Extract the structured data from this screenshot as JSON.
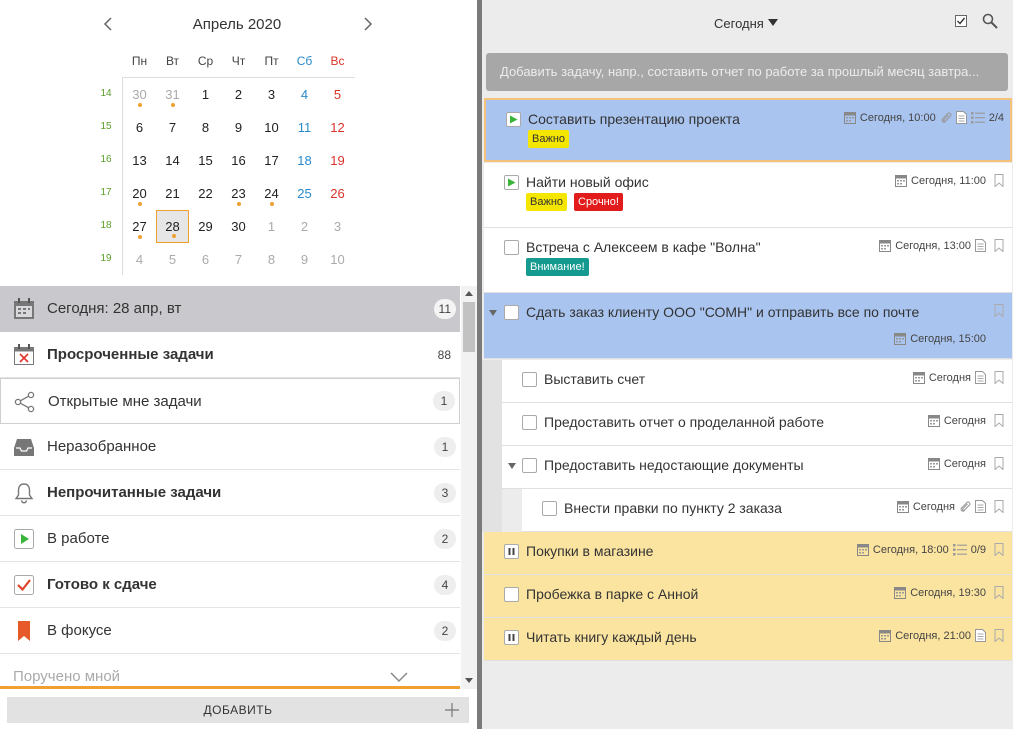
{
  "calendar": {
    "title": "Апрель 2020",
    "prev": "<",
    "next": ">",
    "weekdays": [
      "Пн",
      "Вт",
      "Ср",
      "Чт",
      "Пт",
      "Сб",
      "Вс"
    ],
    "weeknums": [
      "14",
      "15",
      "16",
      "17",
      "18",
      "19"
    ],
    "days": [
      {
        "d": "30",
        "other": true,
        "dot": true
      },
      {
        "d": "31",
        "other": true,
        "dot": true
      },
      {
        "d": "1"
      },
      {
        "d": "2"
      },
      {
        "d": "3"
      },
      {
        "d": "4"
      },
      {
        "d": "5"
      },
      {
        "d": "6"
      },
      {
        "d": "7"
      },
      {
        "d": "8"
      },
      {
        "d": "9"
      },
      {
        "d": "10"
      },
      {
        "d": "11"
      },
      {
        "d": "12"
      },
      {
        "d": "13"
      },
      {
        "d": "14"
      },
      {
        "d": "15"
      },
      {
        "d": "16"
      },
      {
        "d": "17"
      },
      {
        "d": "18"
      },
      {
        "d": "19"
      },
      {
        "d": "20",
        "dot": true
      },
      {
        "d": "21"
      },
      {
        "d": "22"
      },
      {
        "d": "23",
        "dot": true
      },
      {
        "d": "24",
        "dot": true
      },
      {
        "d": "25"
      },
      {
        "d": "26"
      },
      {
        "d": "27",
        "dot": true
      },
      {
        "d": "28",
        "today": true,
        "dot": true
      },
      {
        "d": "29"
      },
      {
        "d": "30"
      },
      {
        "d": "1",
        "other": true
      },
      {
        "d": "2",
        "other": true
      },
      {
        "d": "3",
        "other": true
      },
      {
        "d": "4",
        "other": true
      },
      {
        "d": "5",
        "other": true
      },
      {
        "d": "6",
        "other": true
      },
      {
        "d": "7",
        "other": true
      },
      {
        "d": "8",
        "other": true
      },
      {
        "d": "9",
        "other": true
      },
      {
        "d": "10",
        "other": true
      }
    ]
  },
  "nav": {
    "items": [
      {
        "label": "Сегодня: 28 апр, вт",
        "count": "11",
        "icon": "calendar-icon",
        "selected": true
      },
      {
        "label": "Просроченные задачи",
        "count": "88",
        "icon": "overdue-calendar-icon",
        "bold": true,
        "plain": true
      },
      {
        "label": "Открытые мне задачи",
        "count": "1",
        "icon": "share-icon",
        "boxed": true
      },
      {
        "label": "Неразобранное",
        "count": "1",
        "icon": "inbox-icon"
      },
      {
        "label": "Непрочитанные задачи",
        "count": "3",
        "icon": "bell-icon",
        "bold": true
      },
      {
        "label": "В работе",
        "count": "2",
        "icon": "play-icon"
      },
      {
        "label": "Готово к сдаче",
        "count": "4",
        "icon": "checkmark-icon",
        "bold": true
      },
      {
        "label": "В фокусе",
        "count": "2",
        "icon": "bookmark-icon"
      }
    ],
    "more_label": "Поручено мной"
  },
  "add_button_label": "ДОБАВИТЬ",
  "right": {
    "filter_label": "Сегодня",
    "add_task_placeholder": "Добавить задачу, напр., составить отчет по работе за прошлый месяц завтра..."
  },
  "tasks": [
    {
      "title": "Составить презентацию проекта",
      "date": "Сегодня, 10:00",
      "subtasks": "2/4",
      "tags": [
        {
          "text": "Важно",
          "color": "yellow"
        }
      ]
    },
    {
      "title": "Найти новый офис",
      "date": "Сегодня, 11:00",
      "tags": [
        {
          "text": "Важно",
          "color": "yellow"
        },
        {
          "text": "Срочно!",
          "color": "red"
        }
      ]
    },
    {
      "title": "Встреча с Алексеем в кафе \"Волна\"",
      "date": "Сегодня, 13:00",
      "tags": [
        {
          "text": "Внимание!",
          "color": "teal"
        }
      ]
    },
    {
      "title": "Сдать заказ клиенту ООО \"СОМН\" и отправить все по почте",
      "date": "Сегодня, 15:00"
    },
    {
      "title": "Выставить счет",
      "date": "Сегодня"
    },
    {
      "title": "Предоставить отчет о проделанной работе",
      "date": "Сегодня"
    },
    {
      "title": "Предоставить недостающие документы",
      "date": "Сегодня"
    },
    {
      "title": "Внести правки по пункту 2 заказа",
      "date": "Сегодня"
    },
    {
      "title": "Покупки в магазине",
      "date": "Сегодня, 18:00",
      "subtasks": "0/9"
    },
    {
      "title": "Пробежка в парке с Анной",
      "date": "Сегодня, 19:30"
    },
    {
      "title": "Читать книгу каждый день",
      "date": "Сегодня, 21:00"
    }
  ],
  "colors": {
    "accent": "#f0a030",
    "blue_row": "#a9c4ef",
    "yellow_row": "#fbe4a0"
  }
}
